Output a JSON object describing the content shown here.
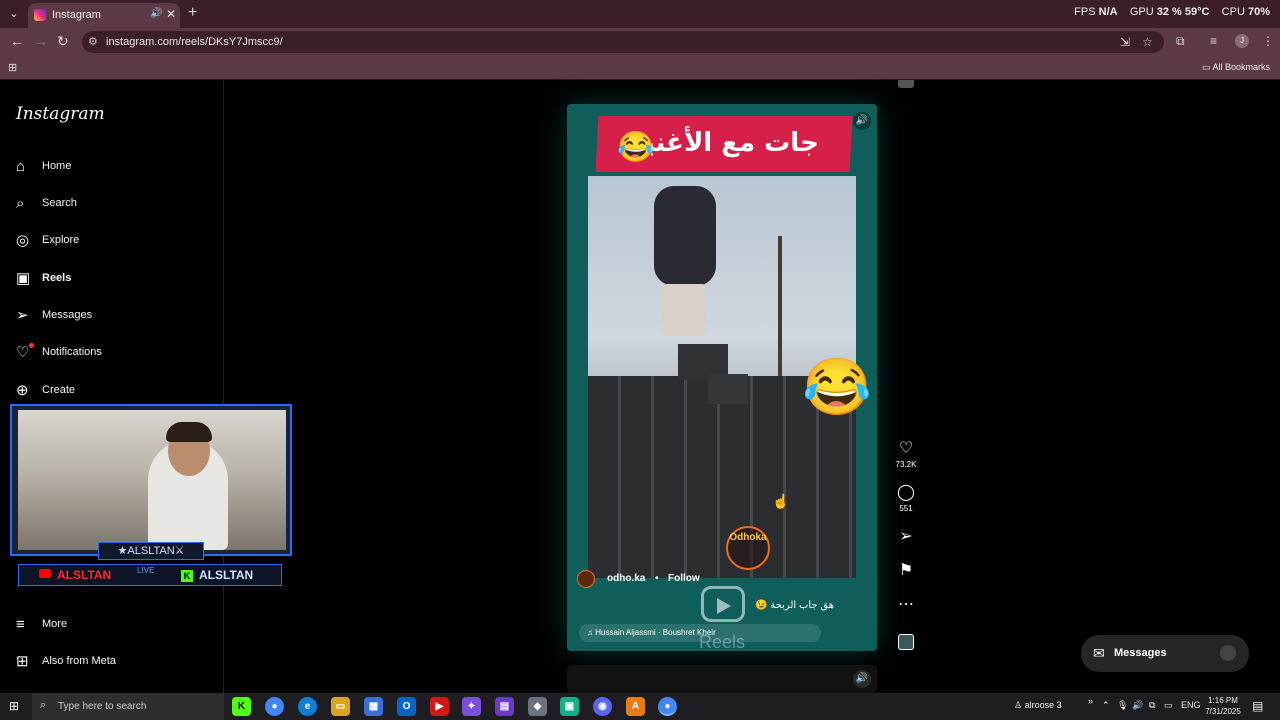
{
  "browser": {
    "tab_title": "Instagram",
    "url": "instagram.com/reels/DKsY7Jmscc9/",
    "all_bookmarks": "All Bookmarks"
  },
  "overlay": {
    "fps_label": "FPS",
    "fps_value": "N/A",
    "gpu_label": "GPU",
    "gpu_value": "32 %",
    "gpu_temp": "59°C",
    "cpu_label": "CPU",
    "cpu_value": "70%"
  },
  "sidebar": {
    "logo": "Instagram",
    "items": [
      {
        "label": "Home",
        "icon": "home-icon",
        "glyph": "⌂"
      },
      {
        "label": "Search",
        "icon": "search-icon",
        "glyph": "⌕"
      },
      {
        "label": "Explore",
        "icon": "compass-icon",
        "glyph": "◎"
      },
      {
        "label": "Reels",
        "icon": "reels-icon",
        "glyph": "▣"
      },
      {
        "label": "Messages",
        "icon": "send-icon",
        "glyph": "➢"
      },
      {
        "label": "Notifications",
        "icon": "heart-icon",
        "glyph": "♡"
      },
      {
        "label": "Create",
        "icon": "plus-icon",
        "glyph": "⊕"
      }
    ],
    "more": "More",
    "also_from_meta": "Also from Meta"
  },
  "webcam": {
    "name_tag": "★ALSLTAN⚔",
    "youtube_name": "ALSLTAN",
    "live_label": "LIVE",
    "kick_name": "ALSLTAN"
  },
  "reel": {
    "banner_text": "جات مع الأغنية",
    "watermark": "Odhoka",
    "author": "odho.ka",
    "separator": "•",
    "follow": "Follow",
    "caption": "هق جاب الربحة 😉",
    "audio": "Hussain Aljassmi · Boushret Kheir",
    "reels_label": "Reels",
    "likes": "73.2K",
    "comments": "551"
  },
  "messages_pill": {
    "label": "Messages"
  },
  "taskbar": {
    "search_placeholder": "Type here to search",
    "user": "alroose 3",
    "language": "ENG",
    "time": "1:16 PM",
    "date": "7/31/2025"
  }
}
